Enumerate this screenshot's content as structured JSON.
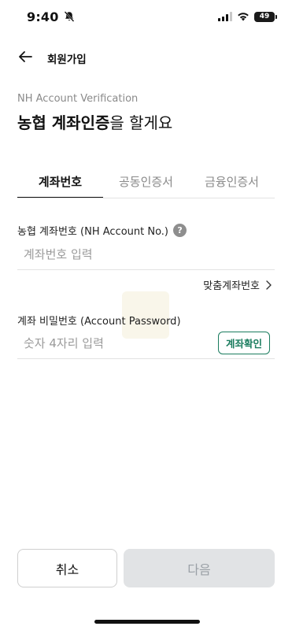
{
  "status_bar": {
    "time": "9:40",
    "battery": "49",
    "icons": [
      "bell-slash-icon",
      "signal-icon",
      "wifi-icon",
      "battery-icon"
    ]
  },
  "header": {
    "back_icon": "arrow-left-icon",
    "title": "회원가입"
  },
  "intro": {
    "subtitle": "NH Account Verification",
    "title_bold": "농협 계좌인증",
    "title_rest": "을 할게요"
  },
  "tabs": [
    {
      "label": "계좌번호",
      "active": true
    },
    {
      "label": "공동인증서",
      "active": false
    },
    {
      "label": "금융인증서",
      "active": false
    }
  ],
  "account_field": {
    "label": "농협 계좌번호 (NH Account No.)",
    "help_icon": "question-circle-icon",
    "help_text": "?",
    "placeholder": "계좌번호 입력",
    "value": ""
  },
  "custom_account_link": {
    "label": "맞춤계좌번호",
    "icon": "chevron-right-icon"
  },
  "password_field": {
    "label": "계좌 비밀번호 (Account Password)",
    "placeholder": "숫자 4자리 입력",
    "value": "",
    "verify_button": "계좌확인"
  },
  "footer": {
    "cancel_label": "취소",
    "next_label": "다음"
  },
  "colors": {
    "accent": "#1a7c5e",
    "text": "#111111",
    "muted": "#8a8a8a",
    "disabled_bg": "#e1e3e5",
    "disabled_text": "#9aa0a6"
  }
}
